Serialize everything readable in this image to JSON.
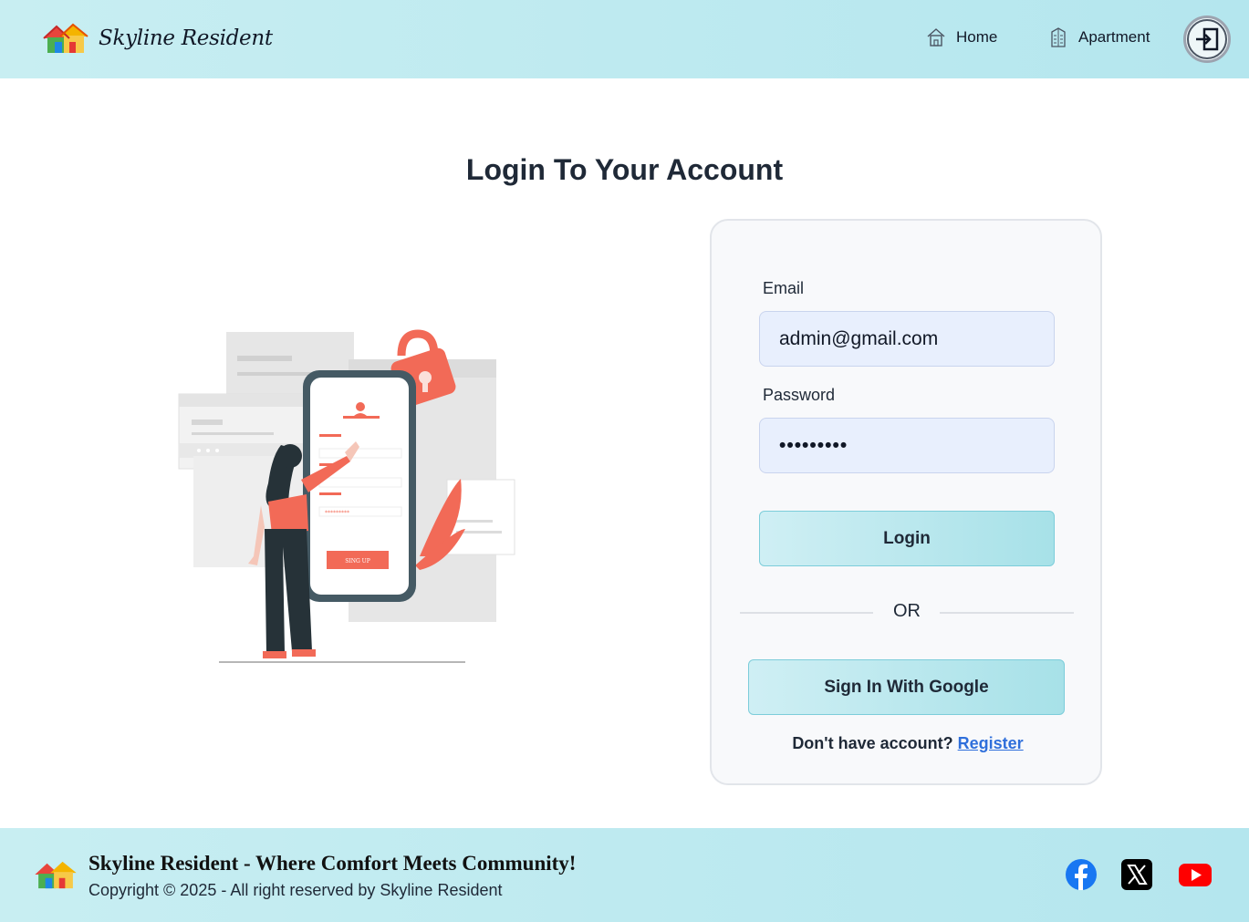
{
  "header": {
    "brand_name": "Skyline Resident",
    "nav": [
      {
        "label": "Home",
        "icon": "home-icon"
      },
      {
        "label": "Apartment",
        "icon": "building-icon"
      }
    ],
    "login_icon": "login-icon"
  },
  "main": {
    "title": "Login To Your Account",
    "illustration": {
      "button_text": "SING UP",
      "icon": "phone-login-illustration"
    }
  },
  "form": {
    "email_label": "Email",
    "email_value": "admin@gmail.com",
    "password_label": "Password",
    "password_value": "•••••••••",
    "login_button": "Login",
    "or_text": "OR",
    "google_button": "Sign In With Google",
    "no_account_text": "Don't have account?",
    "register_link": "Register"
  },
  "footer": {
    "tagline": "Skyline Resident - Where Comfort Meets Community!",
    "copyright": "Copyright © 2025 - All right reserved by Skyline Resident",
    "social": [
      "facebook-icon",
      "x-icon",
      "youtube-icon"
    ]
  },
  "colors": {
    "header_bg": "#c8eef2",
    "accent": "#a7e1e8",
    "input_bg": "#e8effd",
    "link": "#2f6fdb",
    "illustration_accent": "#f26a57"
  }
}
